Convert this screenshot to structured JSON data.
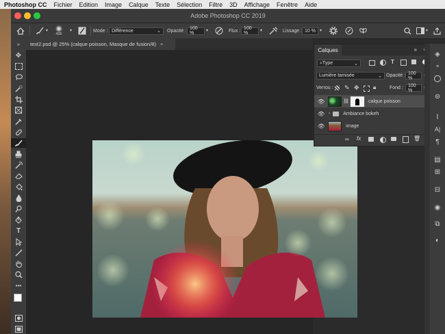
{
  "menubar": {
    "app": "Photoshop CC",
    "items": [
      "Fichier",
      "Edition",
      "Image",
      "Calque",
      "Texte",
      "Sélection",
      "Filtre",
      "3D",
      "Affichage",
      "Fenêtre",
      "Aide"
    ]
  },
  "window": {
    "title": "Adobe Photoshop CC 2019"
  },
  "options": {
    "brush_size": "495",
    "mode_label": "Mode :",
    "mode_value": "Différence",
    "opacity_label": "Opacité :",
    "opacity_value": "100 %",
    "flow_label": "Flux :",
    "flow_value": "100 %",
    "smoothing_label": "Lissage :",
    "smoothing_value": "10 %"
  },
  "document_tab": {
    "title": "test2.psd @ 25% (calque poisson, Masque de fusion/8)",
    "close": "×"
  },
  "layers_panel": {
    "title": "Calques",
    "filter_value": "Type",
    "blend_mode": "Lumière tamisée",
    "opacity_label": "Opacité :",
    "opacity_value": "100 %",
    "lock_label": "Verrou :",
    "fill_label": "Fond :",
    "fill_value": "100 %",
    "layers": [
      {
        "name": "calque poisson",
        "selected": true,
        "kind": "masked"
      },
      {
        "name": "Ambiance bokeh",
        "selected": false,
        "kind": "group"
      },
      {
        "name": "image",
        "selected": false,
        "kind": "pixel"
      }
    ]
  },
  "colors": {
    "accent_selected": "#4e4e4e",
    "traffic_red": "#fe5f57",
    "traffic_yellow": "#febc2e",
    "traffic_green": "#28c840"
  }
}
